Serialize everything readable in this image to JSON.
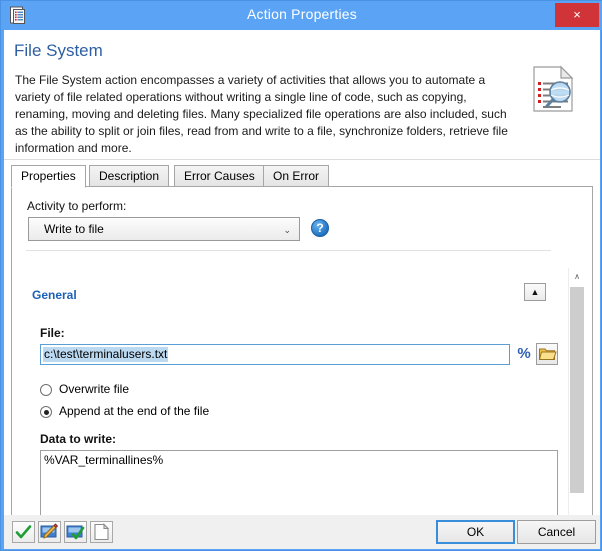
{
  "window": {
    "title": "Action Properties",
    "icon": "properties-document-icon",
    "close_label": "×",
    "titlebar_color": "#5ba4f5",
    "close_color": "#d13438"
  },
  "header": {
    "title": "File System",
    "title_color": "#2e5fa3",
    "description": "The File System action encompasses a variety of activities that allows you to automate a variety of file related operations without writing a single line of code, such as copying, renaming, moving and deleting files. Many specialized file operations are also included, such as the ability to split or join files, read from and write to a file, synchronize folders, retrieve file information and more.",
    "icon": "document-magnifier-icon"
  },
  "tabs": [
    {
      "label": "Properties",
      "active": true
    },
    {
      "label": "Description",
      "active": false
    },
    {
      "label": "Error Causes",
      "active": false
    },
    {
      "label": "On Error",
      "active": false
    }
  ],
  "activity": {
    "label": "Activity to perform:",
    "selected": "Write to file",
    "options": [
      "Write to file"
    ],
    "dropdown_arrow": "⌄",
    "help_icon": "help-question-icon",
    "help_label": "?"
  },
  "general": {
    "section_title": "General",
    "section_color": "#1c61b8",
    "collapse_icon": "▲",
    "file": {
      "label": "File:",
      "value": "c:\\test\\terminalusers.txt",
      "placeholder": "",
      "selected": true,
      "percent_button": "%",
      "percent_icon": "percent-variable-icon",
      "browse_icon": "folder-browse-icon"
    },
    "write_mode": {
      "options": [
        {
          "label": "Overwrite file",
          "checked": false
        },
        {
          "label": "Append at the end of the file",
          "checked": true
        }
      ]
    },
    "data_to_write": {
      "label": "Data to write:",
      "value": "%VAR_terminallines%",
      "placeholder": ""
    }
  },
  "scrollbar": {
    "up_arrow": "∧",
    "down_arrow": "∨"
  },
  "footer": {
    "tools": [
      {
        "name": "validate-check-icon"
      },
      {
        "name": "edit-pencil-icon"
      },
      {
        "name": "apply-check-icon"
      },
      {
        "name": "new-page-icon"
      }
    ],
    "ok_label": "OK",
    "cancel_label": "Cancel"
  }
}
